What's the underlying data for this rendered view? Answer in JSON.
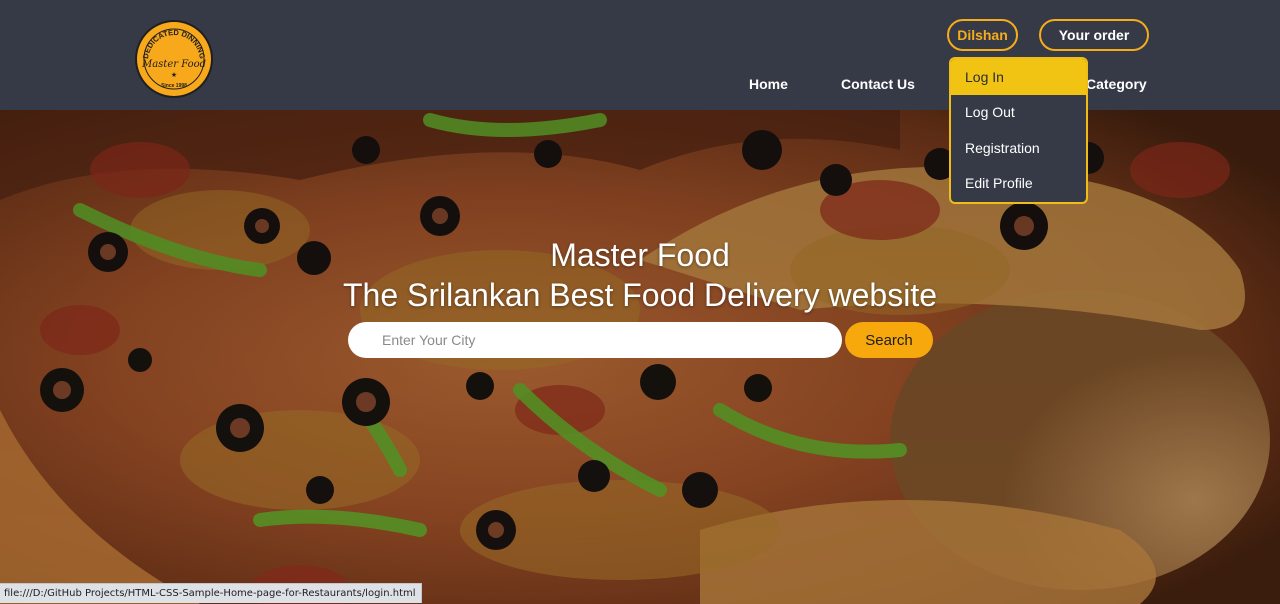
{
  "header": {
    "logo": {
      "top_text": "DEDICATED DINNING",
      "script_text": "Master Food",
      "bottom_text": "Since 1998"
    },
    "user_button_label": "Dilshan",
    "order_button_label": "Your order",
    "nav": {
      "home": "Home",
      "contact": "Contact Us",
      "category": "Category"
    }
  },
  "dropdown": {
    "items": [
      {
        "label": "Log In",
        "active": true
      },
      {
        "label": "Log Out"
      },
      {
        "label": "Registration"
      },
      {
        "label": "Edit Profile"
      }
    ]
  },
  "hero": {
    "title": "Master Food",
    "subtitle": "The Srilankan Best Food Delivery website",
    "search": {
      "placeholder": "Enter Your City",
      "button_label": "Search"
    }
  },
  "status_bar": {
    "url": "file:///D:/GitHub Projects/HTML-CSS-Sample-Home-page-for-Restaurants/login.html"
  },
  "colors": {
    "header_bg": "#363a47",
    "accent": "#f6ad1b",
    "dropdown_active": "#f1c414",
    "search_button": "#f6a80c"
  }
}
